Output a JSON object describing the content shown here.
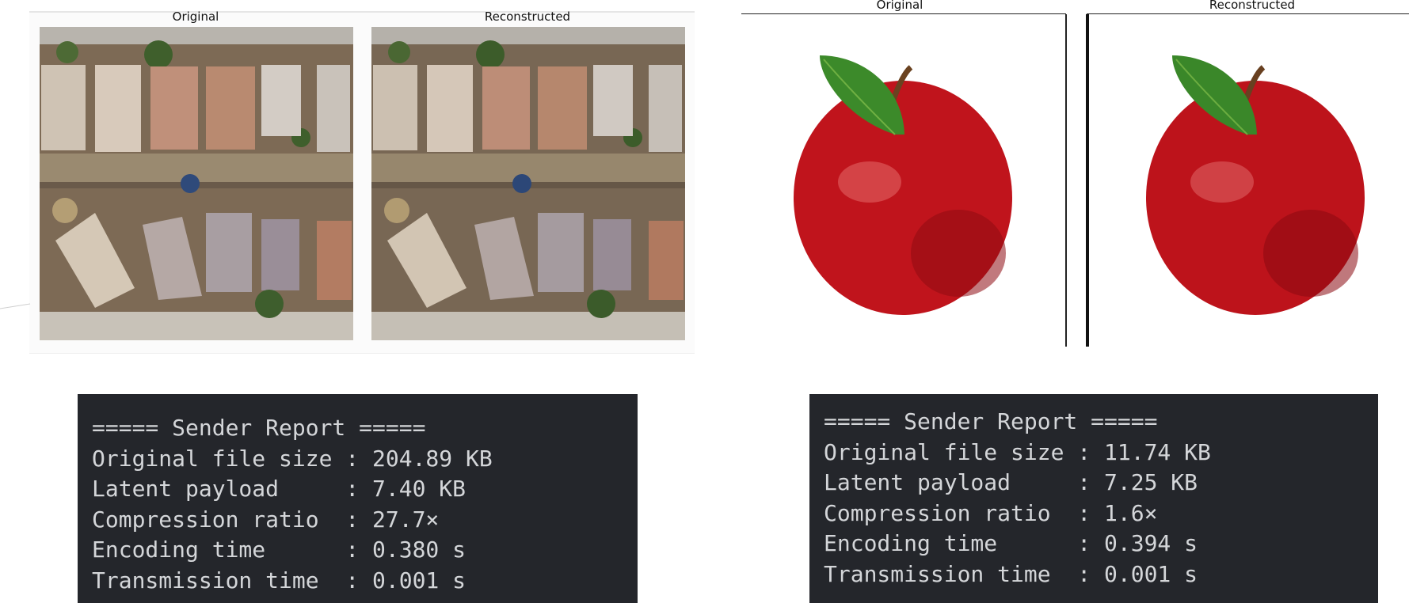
{
  "left_figure": {
    "titles": [
      "Original",
      "Reconstructed"
    ],
    "image_subject": "aerial-neighborhood"
  },
  "right_figure": {
    "titles": [
      "Original",
      "Reconstructed"
    ],
    "image_subject": "red-apple"
  },
  "reports": [
    {
      "header": "===== Sender Report =====",
      "lines": [
        "Original file size : 204.89 KB",
        "Latent payload     : 7.40 KB",
        "Compression ratio  : 27.7×",
        "Encoding time      : 0.380 s",
        "Transmission time  : 0.001 s"
      ]
    },
    {
      "header": "===== Sender Report =====",
      "lines": [
        "Original file size : 11.74 KB",
        "Latent payload     : 7.25 KB",
        "Compression ratio  : 1.6×",
        "Encoding time      : 0.394 s",
        "Transmission time  : 0.001 s"
      ]
    }
  ],
  "colors": {
    "terminal_bg": "#24262b",
    "terminal_text": "#d4d6d9",
    "apple_red": "#c0141c",
    "leaf_green": "#3c8a2a"
  }
}
